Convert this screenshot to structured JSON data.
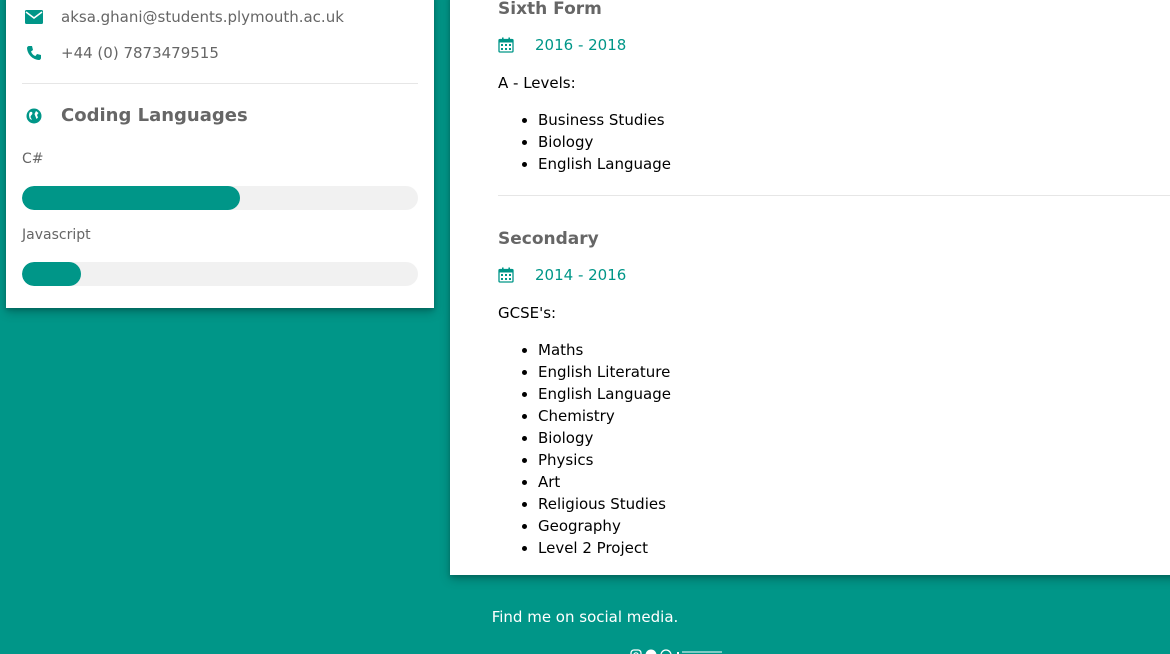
{
  "contact": {
    "email": "aksa.ghani@students.plymouth.ac.uk",
    "phone": "+44 (0) 7873479515",
    "email_icon": "envelope-icon",
    "phone_icon": "phone-icon"
  },
  "skills": {
    "heading": "Coding Languages",
    "heading_icon": "globe-icon",
    "items": [
      {
        "label": "C#",
        "level": 0.55
      },
      {
        "label": "Javascript",
        "level": 0.15
      }
    ]
  },
  "education": [
    {
      "title": "Sixth Form",
      "date": "2016 - 2018",
      "type": "A - Levels:",
      "subjects": [
        "Business Studies",
        "Biology",
        "English Language"
      ]
    },
    {
      "title": "Secondary",
      "date": "2014 - 2016",
      "type": "GCSE's:",
      "subjects": [
        "Maths",
        "English Literature",
        "English Language",
        "Chemistry",
        "Biology",
        "Physics",
        "Art",
        "Religious Studies",
        "Geography",
        "Level 2 Project"
      ]
    }
  ],
  "footer": {
    "text": "Find me on social media.",
    "icons": [
      "instagram-icon",
      "pinterest-icon",
      "snapchat-icon",
      "linkedin-icon"
    ]
  },
  "colors": {
    "accent": "#009688",
    "track": "#f1f1f1"
  }
}
